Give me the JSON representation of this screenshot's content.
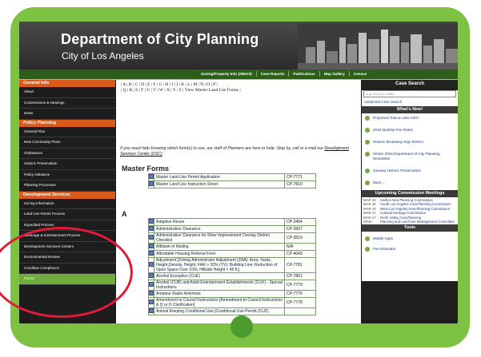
{
  "header": {
    "title": "Department of City Planning",
    "subtitle": "City of Los Angeles"
  },
  "topnav": [
    "Zoning/Property Info (ZIMAS)",
    "Case Reports",
    "Publications",
    "Map Gallery",
    "Census"
  ],
  "left_nav": {
    "general_heading": "General Info",
    "general_items": [
      "About",
      "Commissions & Hearings",
      "News"
    ],
    "policy_heading": "Policy Planning",
    "policy_items": [
      "General Plan",
      "New Community Plans",
      "Ordinances",
      "Historic Preservation",
      "Policy Initiatives",
      "Planning Processes"
    ],
    "dev_heading": "Development Services",
    "dev_items": [
      "Zoning Information",
      "Land Use Permit Process",
      "Expedited Process",
      "Beverage & Entertainment Process",
      "Development Services Centers",
      "Environmental Review",
      "Condition Compliance",
      "Forms"
    ]
  },
  "content": {
    "alpha_line1": "| A | B | C | D | E | F | G | H | I | J | K | L | M | N | O | P |",
    "alpha_line2": "| Q | R | S | T | U | V | W | X | Y | Z | View Master Land Use Forms |",
    "intro_text": "If you need help knowing which form(s) to use, our staff of Planners are here to help. Stop by, call or e-mail our",
    "intro_link": "Development Services Center (DSC)",
    "intro_end": ".",
    "master_heading": "Master Forms",
    "master_forms": [
      {
        "name": "Master Land Use Permit Application",
        "code": "CP-7771"
      },
      {
        "name": "Master Land Use Instruction Sheet",
        "code": "CP-7810"
      }
    ],
    "a_heading": "A",
    "a_forms": [
      {
        "name": "Adaptive Reuse",
        "code": "CP-2404"
      },
      {
        "name": "Administrative Clearance",
        "code": "CP-3507"
      },
      {
        "name": "Administrative Clearance for River Improvement Overlay District Checklist",
        "code": "CP-3519"
      },
      {
        "name": "Affidavit of Mailing",
        "code": "N/A"
      },
      {
        "name": "Affordable Housing Referral Form",
        "code": "CP-4043"
      },
      {
        "name": "Adjustment [Zoning Administrator Adjustment (ZAA): Area, Yards, Height,Density, Height, FAR > 20% (YV); Building Line; Reduction of Open Space Over 10%; Hillside Height > 45 ft.]",
        "code": "CP-7781"
      },
      {
        "name": "Alcohol Exception (CUE)",
        "code": "CP-7801"
      },
      {
        "name": "Alcohol (CUB) and Adult Entertainment Establishments (CUX) - Special Instructions",
        "code": "CP-7773"
      },
      {
        "name": "Amateur Radio Antennas",
        "code": "CP-7770"
      },
      {
        "name": "Amendment to Council Instructions [Amendment to Council Instructions & Q or D Clarification]",
        "code": "CP-7778"
      },
      {
        "name": "Animal Keeping Conditional Use [Conditional Use Permit (CUZ)",
        "code": ""
      }
    ]
  },
  "right": {
    "case_search_heading": "Case Search",
    "case_search_placeholder": "(e.g. ZA-2011-3056)",
    "advanced_link": "Advanced Case Search",
    "whats_new_heading": "What's New!",
    "news": [
      "Proposed Toluca Lake CDO",
      "2016 Quimby Fee Rates",
      "Historic Broadway Sign District",
      "Winter 2016 Department of City Planning Newsletter",
      "January Historic Preservation",
      "More ..."
    ],
    "commission_heading": "Upcoming Commission Meetings",
    "meetings": [
      {
        "date": "MAR 15",
        "name": "Harbor Area Planning Commission"
      },
      {
        "date": "MAR 15",
        "name": "South Los Angeles Area Planning Commission"
      },
      {
        "date": "MAR 16",
        "name": "West Los Angeles Area Planning Commission"
      },
      {
        "date": "MAR 17",
        "name": "Cultural Heritage Commission"
      },
      {
        "date": "MAR 17",
        "name": "North Valley Area Planning"
      },
      {
        "date": "Other:",
        "name": "Planning and Land Use Management Committee"
      }
    ],
    "tools_heading": "Tools",
    "tools": [
      "Mobile Apps",
      "Fee Estimator"
    ]
  }
}
